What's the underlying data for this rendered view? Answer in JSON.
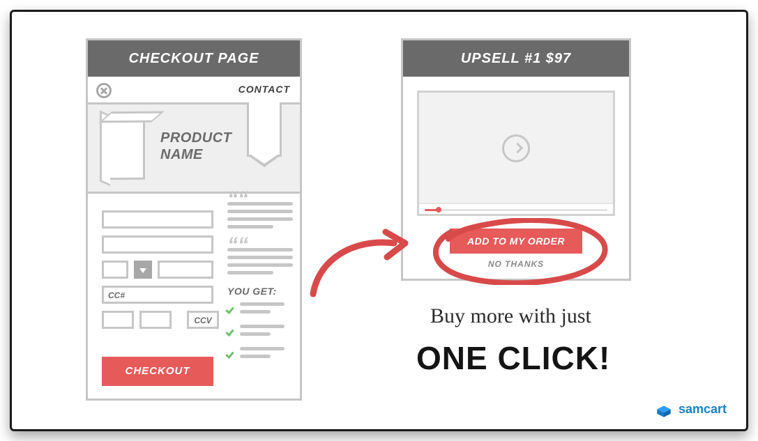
{
  "checkout": {
    "header": "CHECKOUT PAGE",
    "contact_label": "CONTACT",
    "product_name_line1": "PRODUCT",
    "product_name_line2": "NAME",
    "cc_placeholder": "CC#",
    "ccv_placeholder": "CCV",
    "you_get_label": "YOU GET:",
    "checkout_button": "CHECKOUT"
  },
  "upsell": {
    "header": "UPSELL #1 $97",
    "add_button": "ADD TO MY ORDER",
    "no_thanks": "NO THANKS"
  },
  "tagline": {
    "line1": "Buy more with just",
    "line2": "ONE CLICK!"
  },
  "logo": {
    "brand": "samcart"
  }
}
